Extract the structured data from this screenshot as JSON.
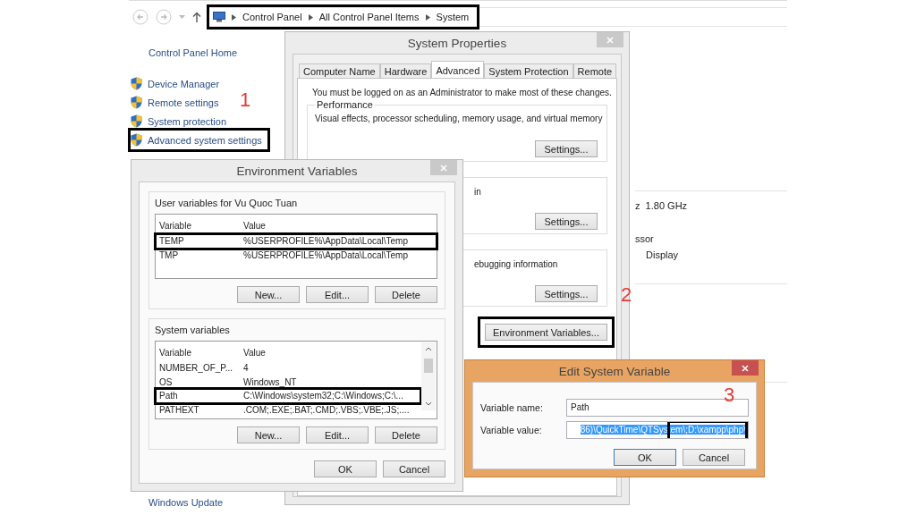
{
  "control_panel": {
    "breadcrumb": {
      "items": [
        "Control Panel",
        "All Control Panel Items",
        "System"
      ],
      "highlighted": true
    },
    "sidebar_title": "Control Panel Home",
    "sidebar_items": [
      {
        "label": "Device Manager",
        "highlighted": false
      },
      {
        "label": "Remote settings",
        "highlighted": false
      },
      {
        "label": "System protection",
        "highlighted": false
      },
      {
        "label": "Advanced system settings",
        "highlighted": true
      }
    ],
    "details": [
      "z  1.80 GHz",
      "ssor",
      "Display"
    ],
    "see_also": "Windows Update"
  },
  "system_properties": {
    "title": "System Properties",
    "active": false,
    "tabs": [
      {
        "label": "Computer Name",
        "selected": false
      },
      {
        "label": "Hardware",
        "selected": false
      },
      {
        "label": "Advanced",
        "selected": true
      },
      {
        "label": "System Protection",
        "selected": false
      },
      {
        "label": "Remote",
        "selected": false
      }
    ],
    "admin_note": "You must be logged on as an Administrator to make most of these changes.",
    "groups": [
      {
        "title": "Performance",
        "description": "Visual effects, processor scheduling, memory usage, and virtual memory",
        "button": "Settings..."
      },
      {
        "description": "in",
        "button": "Settings..."
      },
      {
        "description": "ebugging information",
        "button": "Settings..."
      }
    ],
    "env_button": {
      "label": "Environment Variables...",
      "highlighted": true
    }
  },
  "environment_variables": {
    "title": "Environment Variables",
    "active": false,
    "sections": [
      {
        "title": "User variables for Vu Quoc Tuan",
        "columns": [
          "Variable",
          "Value"
        ],
        "rows": [
          {
            "variable": "TEMP",
            "value": "%USERPROFILE%\\AppData\\Local\\Temp",
            "highlighted": true
          },
          {
            "variable": "TMP",
            "value": "%USERPROFILE%\\AppData\\Local\\Temp",
            "highlighted": false
          }
        ],
        "buttons": [
          "New...",
          "Edit...",
          "Delete"
        ]
      },
      {
        "title": "System variables",
        "columns": [
          "Variable",
          "Value"
        ],
        "rows": [
          {
            "variable": "NUMBER_OF_P...",
            "value": "4",
            "highlighted": false
          },
          {
            "variable": "OS",
            "value": "Windows_NT",
            "highlighted": false
          },
          {
            "variable": "Path",
            "value": "C:\\Windows\\system32;C:\\Windows;C:\\...",
            "highlighted": true
          },
          {
            "variable": "PATHEXT",
            "value": ".COM;.EXE;.BAT;.CMD;.VBS;.VBE;.JS;....",
            "highlighted": false
          }
        ],
        "buttons": [
          "New...",
          "Edit...",
          "Delete"
        ]
      }
    ],
    "buttons": [
      "OK",
      "Cancel"
    ]
  },
  "edit_variable": {
    "title": "Edit System Variable",
    "active": true,
    "fields": [
      {
        "label": "Variable name:",
        "value": "Path",
        "text_selected": false
      },
      {
        "label": "Variable value:",
        "value": "86)\\QuickTime\\QTSystem\\;D:\\xampp\\php\\",
        "text_selected": true,
        "highlighted": true
      }
    ],
    "buttons": [
      "OK",
      "Cancel"
    ]
  },
  "step_markers": [
    "1",
    "2",
    "3"
  ]
}
